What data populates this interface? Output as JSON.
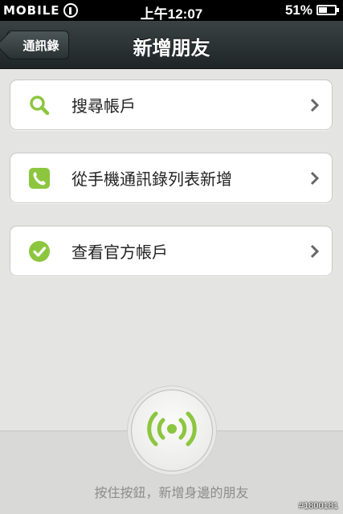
{
  "status_bar": {
    "brand": "MOBILE",
    "time": "上午12:07",
    "battery": "51%"
  },
  "nav": {
    "back_label": "通訊錄",
    "title": "新增朋友"
  },
  "menu": [
    {
      "label": "搜尋帳戶",
      "icon": "search-icon"
    },
    {
      "label": "從手機通訊錄列表新增",
      "icon": "phone-icon"
    },
    {
      "label": "查看官方帳戶",
      "icon": "check-icon"
    }
  ],
  "bottom": {
    "hint": "按住按鈕，新增身邊的朋友",
    "button_icon": "broadcast-icon"
  },
  "watermark": "#1800181",
  "colors": {
    "accent_green": "#8cc63f",
    "nav_dark": "#2a3133",
    "background": "#e4e4e2"
  }
}
